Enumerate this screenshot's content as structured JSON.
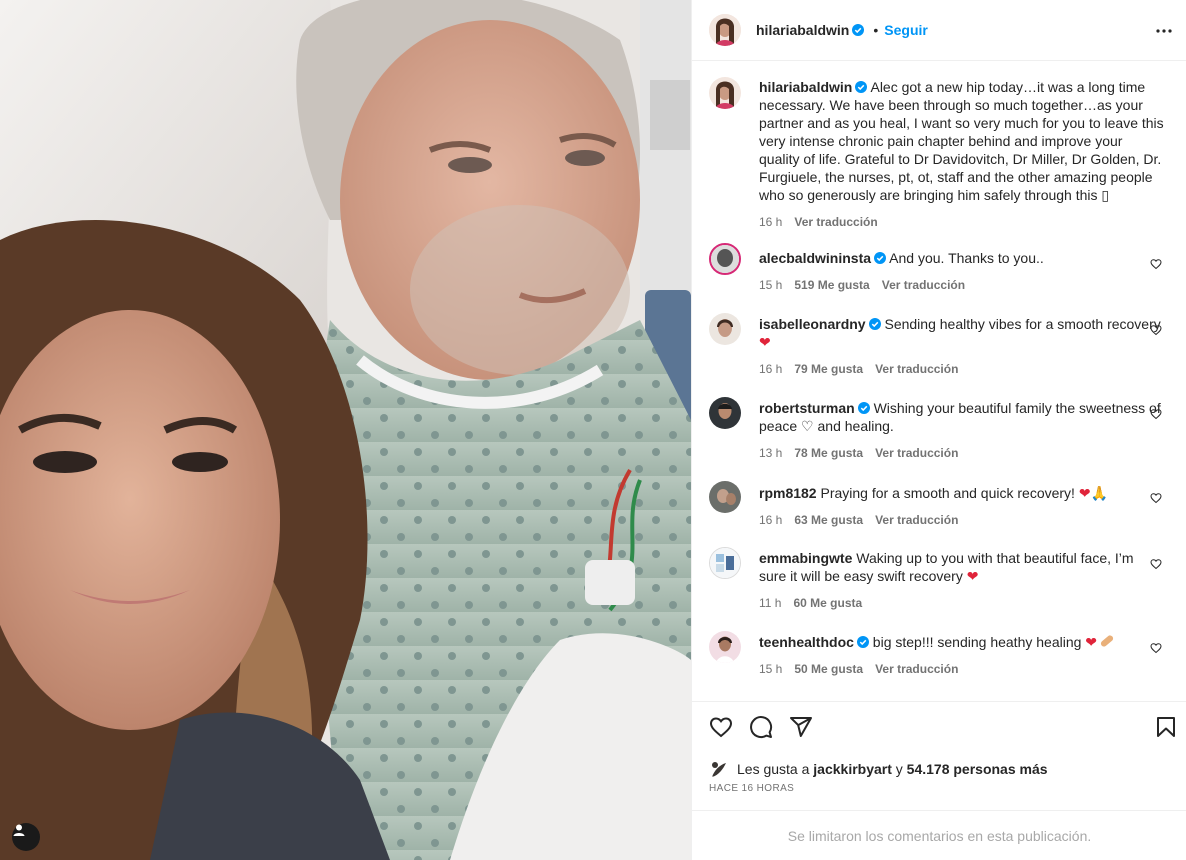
{
  "post": {
    "username": "hilariabaldwin",
    "follow_label": "Seguir",
    "separator": "•",
    "caption": "Alec got a new hip today…it was a long time necessary. We have been through so much together…as your partner and as you heal, I want so very much for you to leave this very intense chronic pain chapter behind and improve your quality of life. Grateful to Dr Davidovitch, Dr Miller, Dr Golden, Dr. Furgiuele, the nurses, pt, ot, staff and the other amazing people who so generously are bringing him safely through this ▯",
    "caption_time": "16 h",
    "translate_label": "Ver traducción"
  },
  "comments": [
    {
      "username": "alecbaldwininsta",
      "verified": true,
      "text": "And you. Thanks to you..",
      "time": "15 h",
      "likes": "519 Me gusta",
      "translate": "Ver traducción"
    },
    {
      "username": "isabelleonardny",
      "verified": true,
      "text": "Sending healthy vibes for a smooth recovery",
      "emoji": [
        "heart"
      ],
      "time": "16 h",
      "likes": "79 Me gusta",
      "translate": "Ver traducción"
    },
    {
      "username": "robertsturman",
      "verified": true,
      "text": "Wishing your beautiful family the sweetness of peace",
      "text2": "and healing.",
      "emoji": [
        "white-heart"
      ],
      "time": "13 h",
      "likes": "78 Me gusta",
      "translate": "Ver traducción"
    },
    {
      "username": "rpm8182",
      "verified": false,
      "text": "Praying for a smooth and quick recovery!",
      "emoji": [
        "heart",
        "praying-hands"
      ],
      "time": "16 h",
      "likes": "63 Me gusta",
      "translate": "Ver traducción"
    },
    {
      "username": "emmabingwte",
      "verified": false,
      "text": "Waking up to you with that beautiful face, I’m sure it will be easy swift recovery",
      "emoji": [
        "heart"
      ],
      "time": "11 h",
      "likes": "60 Me gusta"
    },
    {
      "username": "teenhealthdoc",
      "verified": true,
      "text": "big step!!! sending heathy healing",
      "emoji": [
        "heart",
        "bandage"
      ],
      "time": "15 h",
      "likes": "50 Me gusta",
      "translate": "Ver traducción"
    }
  ],
  "likes_summary": {
    "prefix": "Les gusta a",
    "user": "jackkirbyart",
    "connector": "y",
    "others": "54.178 personas más"
  },
  "time_ago": "HACE 16 HORAS",
  "comments_limited": "Se limitaron los comentarios en esta publicación.",
  "icons": [
    "verified-badge-icon",
    "more-options-icon",
    "heart-icon",
    "comment-icon",
    "share-icon",
    "bookmark-icon",
    "user-tag-icon"
  ],
  "colors": {
    "accent": "#0095f6",
    "verified": "#0095f6",
    "heart": "#ed4956",
    "text": "#262626",
    "muted": "#737373"
  }
}
